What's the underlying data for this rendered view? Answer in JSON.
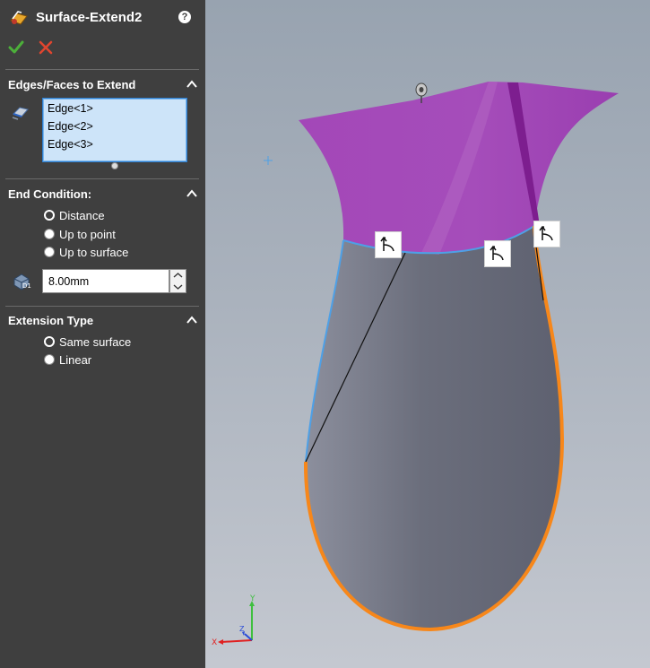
{
  "panel": {
    "title": "Surface-Extend2",
    "help_label": "?",
    "sections": {
      "edges": {
        "title": "Edges/Faces to Extend",
        "items": [
          "Edge<1>",
          "Edge<2>",
          "Edge<3>"
        ]
      },
      "end_condition": {
        "title": "End Condition:",
        "options": [
          {
            "label": "Distance",
            "selected": true
          },
          {
            "label": "Up to point",
            "selected": false
          },
          {
            "label": "Up to surface",
            "selected": false
          }
        ],
        "distance_value": "8.00mm"
      },
      "extension_type": {
        "title": "Extension Type",
        "options": [
          {
            "label": "Same surface",
            "selected": true
          },
          {
            "label": "Linear",
            "selected": false
          }
        ]
      }
    }
  },
  "viewport": {
    "triad": {
      "x_label": "X",
      "y_label": "Y",
      "z_label": "Z"
    },
    "colors": {
      "surface_top": "#a347b8",
      "body": "#6b6e7c",
      "edge_highlight": "#f7871a",
      "edge_blue": "#4ea0e6"
    }
  }
}
